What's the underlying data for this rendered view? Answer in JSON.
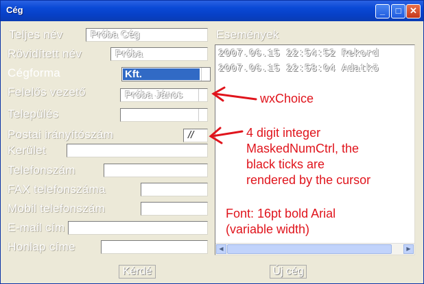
{
  "window": {
    "title": "Cég",
    "minimize": "_",
    "maximize": "□",
    "close": "✕"
  },
  "form": {
    "labels": {
      "full_name": "Teljes név",
      "short_name": "Rövidített név",
      "company_form": "Cégforma",
      "manager": "Felelős vezető",
      "settlement": "Település",
      "postcode": "Postai irányítószám",
      "district": "Kerület",
      "phone": "Telefonszám",
      "fax": "FAX telefonszáma",
      "mobile": "Mobil telefonszám",
      "email": "E-mail cím",
      "homepage": "Honlap címe"
    },
    "values": {
      "full_name": "Próba Cég",
      "short_name": "Próba",
      "company_form": "Kft.",
      "manager": "Próba János",
      "settlement": "",
      "postcode": "//",
      "district": "",
      "phone": "",
      "fax": "",
      "mobile": "",
      "email": "",
      "homepage": ""
    }
  },
  "events": {
    "label": "Események",
    "rows": [
      "2007.06.15 22:54:52  Rekord",
      "2007.06.15 22:58:04  Adatkö"
    ]
  },
  "buttons": {
    "ok": "Kérdé",
    "new": "Új cég"
  },
  "annotations": {
    "choice": "wxChoice",
    "masked": [
      "4 digit integer",
      "MaskedNumCtrl, the",
      "black ticks are",
      "rendered by the cursor"
    ],
    "font": [
      "Font: 16pt bold Arial",
      "(variable width)"
    ]
  },
  "colors": {
    "annotation": "#e0141c",
    "selection": "#316ac5",
    "titlebar": "#0a49d6"
  }
}
